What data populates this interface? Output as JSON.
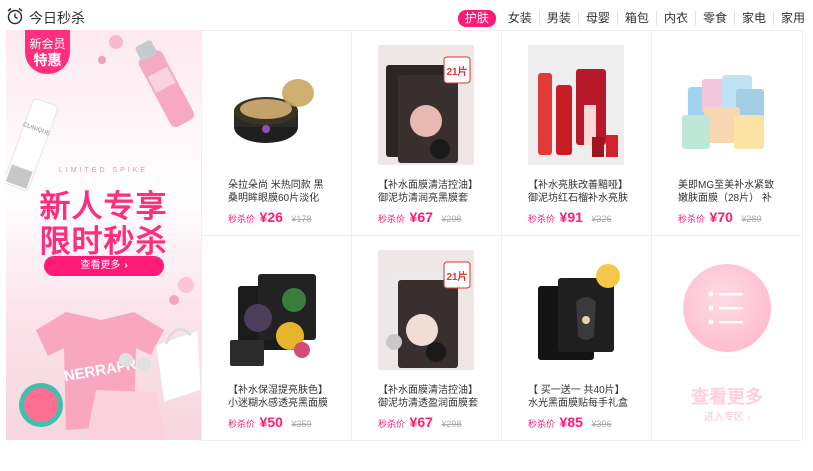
{
  "header": {
    "title": "今日秒杀",
    "tabs": [
      {
        "label": "护肤",
        "active": true
      },
      {
        "label": "女装"
      },
      {
        "label": "男装"
      },
      {
        "label": "母婴"
      },
      {
        "label": "箱包"
      },
      {
        "label": "内衣"
      },
      {
        "label": "零食"
      },
      {
        "label": "家电"
      },
      {
        "label": "家用"
      }
    ]
  },
  "banner": {
    "badge_line1": "新会员",
    "badge_line2": "特惠",
    "tagline": "LIMITED SPIKE",
    "headline1": "新人专享",
    "headline2": "限时秒杀",
    "button_label": "查看更多",
    "button_arrow": "›"
  },
  "products": [
    {
      "name": "朵拉朵尚 米热同款 黑桑明眸眼膜60片淡化",
      "price_label": "秒杀价",
      "currency": "¥",
      "price": "26",
      "original": "¥178"
    },
    {
      "name": "【补水面膜清洁控油】御泥坊清润亮黑膜套",
      "price_label": "秒杀价",
      "currency": "¥",
      "price": "67",
      "original": "¥298"
    },
    {
      "name": "【补水亮肤改善黯哑】御泥坊红石榴补水亮肤",
      "price_label": "秒杀价",
      "currency": "¥",
      "price": "91",
      "original": "¥326"
    },
    {
      "name": "美即MG至美补水紧致嫩肤面膜（28片） 补",
      "price_label": "秒杀价",
      "currency": "¥",
      "price": "70",
      "original": "¥280"
    },
    {
      "name": "【补水保湿提亮肤色】小迷糊水感透亮黑面膜",
      "price_label": "秒杀价",
      "currency": "¥",
      "price": "50",
      "original": "¥359"
    },
    {
      "name": "【补水面膜清洁控油】御泥坊清透盈润面膜套",
      "price_label": "秒杀价",
      "currency": "¥",
      "price": "67",
      "original": "¥298"
    },
    {
      "name": "【 买一送一 共40片】水光黑面膜贴每手礼盒",
      "price_label": "秒杀价",
      "currency": "¥",
      "price": "85",
      "original": "¥396"
    }
  ],
  "badge_21": "21片",
  "more": {
    "title": "查看更多",
    "subtitle": "进入专区"
  },
  "colors": {
    "accent": "#ff1a77",
    "banner_pink": "#ff2d7d"
  }
}
